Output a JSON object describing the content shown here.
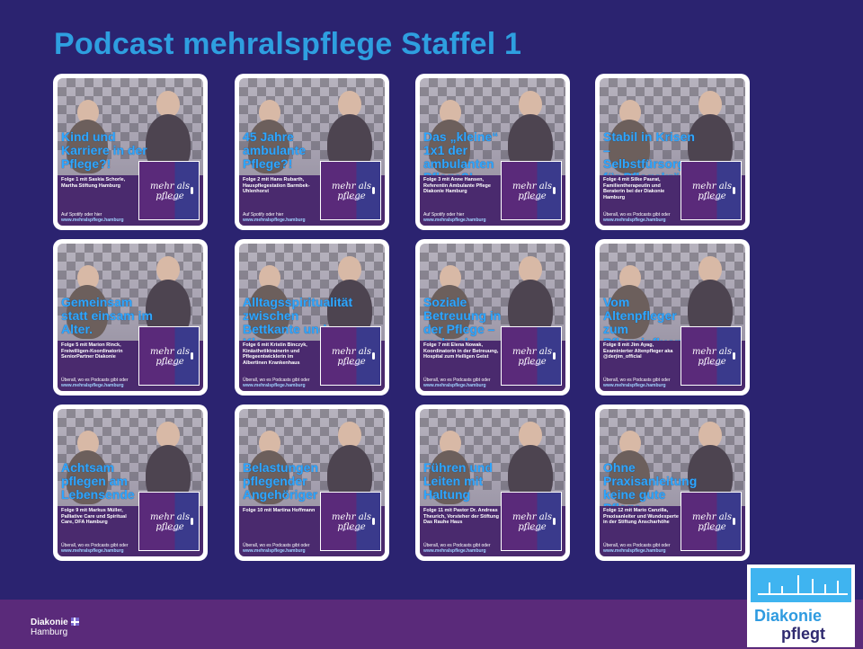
{
  "title": "Podcast mehralspflege Staffel 1",
  "logo_text": "mehr als pflege",
  "logo_sub": "Der Podcast",
  "episodes": [
    {
      "title": "Kind und Karriere in der Pflege?!",
      "info": "Folge 1 mit Saskia Schorle, Martha Stiftung Hamburg",
      "footer1": "Auf Spotify oder hier",
      "footer2": "www.mehralspflege.hamburg"
    },
    {
      "title": "45 Jahre ambulante Pflege?!",
      "info": "Folge 2 mit Hans Rubarth, Hauspflegestation Barmbek-Uhlenhorst",
      "footer1": "Auf Spotify oder hier",
      "footer2": "www.mehralspflege.hamburg"
    },
    {
      "title": "Das „kleine“ 1x1 der ambulanten Pflege?!",
      "info": "Folge 3 mit Anne Hansen, Referentin Ambulante Pflege Diakonie Hamburg",
      "footer1": "Auf Spotify oder hier",
      "footer2": "www.mehralspflege.hamburg"
    },
    {
      "title": "Stabil in Krisen – Selbstfürsorge für Pflegekräfte",
      "info": "Folge 4 mit Silke Paurat, Familientherapeutin und Beraterin bei der Diakonie Hamburg",
      "footer1": "Überall, wo es Podcasts gibt oder",
      "footer2": "www.mehralspflege.hamburg"
    },
    {
      "title": "Gemeinsam statt einsam im Alter.",
      "info": "Folge 5 mit Marion Rinck, Freiwilligen-Koordinatorin SeniorPartner Diakonie",
      "footer1": "Überall, wo es Podcasts gibt oder",
      "footer2": "www.mehralspflege.hamburg"
    },
    {
      "title": "Alltagsspiritualität zwischen Bettkante und Klo",
      "info": "Folge 6 mit Kristin Binczyk, Kinästhetiktrainerin und Pflegeentwicklerin im Albertinen Krankenhaus",
      "footer1": "Überall, wo es Podcasts gibt oder",
      "footer2": "www.mehralspflege.hamburg"
    },
    {
      "title": "Soziale Betreuung in der Pflege – mehr als Entertainment",
      "info": "Folge 7 mit Elena Nowak, Koordinatorin in der Betreuung, Hospital zum Heiligen Geist",
      "footer1": "Überall, wo es Podcasts gibt oder",
      "footer2": "www.mehralspflege.hamburg"
    },
    {
      "title": "Vom Altenpfleger zum Pflegeinfluencer",
      "info": "Folge 8 mit Jim Ayag, Examinierter Altenpfleger aka @derjim_official",
      "footer1": "Überall, wo es Podcasts gibt oder",
      "footer2": "www.mehralspflege.hamburg"
    },
    {
      "title": "Achtsam pflegen am Lebensende",
      "info": "Folge 9 mit Markus Müller, Palliative Care und Spiritual Care, DFA Hamburg",
      "footer1": "Überall, wo es Podcasts gibt oder",
      "footer2": "www.mehralspflege.hamburg"
    },
    {
      "title": "Belastungen pflegender Angehöriger",
      "info": "Folge 10 mit Martina Hoffmann",
      "footer1": "Überall, wo es Podcasts gibt oder",
      "footer2": "www.mehralspflege.hamburg"
    },
    {
      "title": "Führen und Leiten mit Haltung",
      "info": "Folge 11 mit Pastor Dr. Andreas Theurich, Vorsteher der Stiftung Das Rauhe Haus",
      "footer1": "Überall, wo es Podcasts gibt oder",
      "footer2": "www.mehralspflege.hamburg"
    },
    {
      "title": "Ohne Praxisanleitung keine gute Pflege",
      "info": "Folge 12 mit Mario Canzilla, Praxisanleiter und Wundexperte in der Stiftung Anscharhöhe",
      "footer1": "Überall, wo es Podcasts gibt oder",
      "footer2": "www.mehralspflege.hamburg"
    }
  ],
  "footer": {
    "brand": "Diakonie",
    "city": "Hamburg"
  },
  "badge": {
    "line1": "Diakonie",
    "line2": "pflegt"
  }
}
